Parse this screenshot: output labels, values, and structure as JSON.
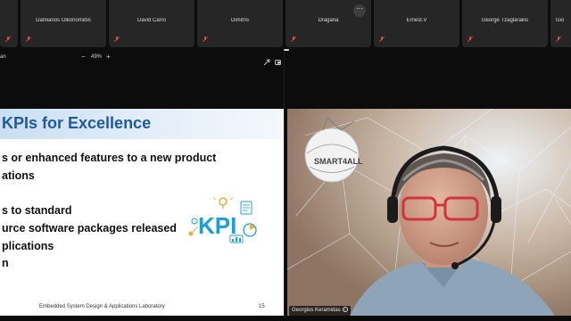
{
  "participants": [
    {
      "name": ""
    },
    {
      "name": "Damianos Oikonomidis"
    },
    {
      "name": "David Carro"
    },
    {
      "name": "Dimitris"
    },
    {
      "name": "Dragana"
    },
    {
      "name": "Ernest.V"
    },
    {
      "name": "George Tzaglarakis"
    },
    {
      "name": "Gio"
    }
  ],
  "more_button": "···",
  "toolbar": {
    "presenter_fragment": "an",
    "zoom_out": "−",
    "zoom_level": "49%",
    "zoom_in": "+"
  },
  "slide": {
    "title": "KPIs for Excellence",
    "bullets": [
      "s or enhanced features to a new product",
      "ations",
      "s to standard",
      "urce software packages released",
      "plications",
      "n"
    ],
    "logo_text": "KPI",
    "footer": "Embedded System Design & Applications Laboratory",
    "page_number": "15"
  },
  "camera": {
    "speaker_name": "Georgios Keramidas",
    "logo_text": "SMART4ALL"
  },
  "colors": {
    "tile_bg": "#262626",
    "mic_muted": "#d84a4a",
    "slide_title": "#1f5aa0",
    "kpi_blue": "#1aa0d8"
  }
}
